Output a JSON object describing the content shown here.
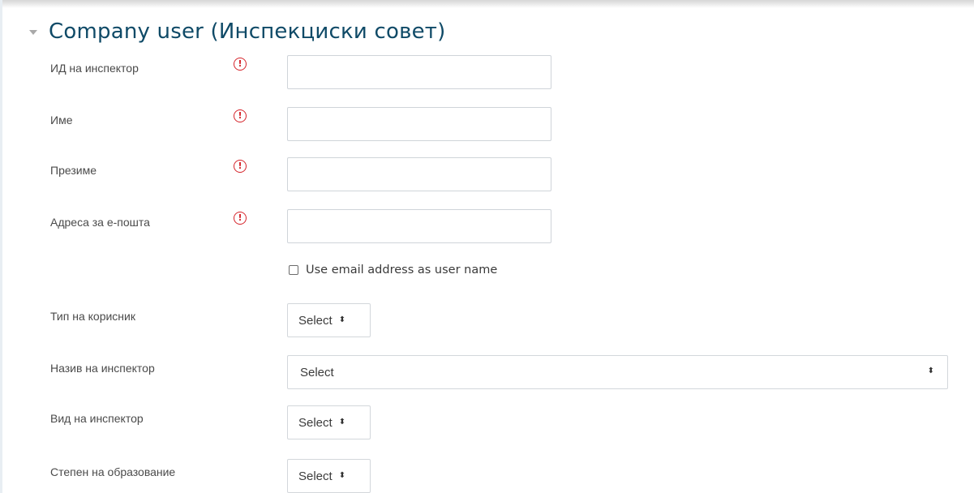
{
  "section": {
    "title": "Company user (Инспекциски совет)",
    "collapse_icon": "caret-down-icon"
  },
  "fields": {
    "inspector_id": {
      "label": "ИД на инспектор",
      "value": ""
    },
    "first_name": {
      "label": "Име",
      "value": ""
    },
    "last_name": {
      "label": "Презиме",
      "value": ""
    },
    "email": {
      "label": "Адреса за е-пошта",
      "value": ""
    }
  },
  "required_icon": {
    "name": "required-icon",
    "glyph": "!"
  },
  "use_email_checkbox": {
    "label": "Use email address as user name",
    "checked": false
  },
  "selects": {
    "user_type": {
      "label": "Тип на корисник",
      "value": "Select"
    },
    "inspector_title": {
      "label": "Назив на инспектор",
      "value": "Select"
    },
    "inspector_kind": {
      "label": "Вид на инспектор",
      "value": "Select"
    },
    "education_level": {
      "label": "Степен на образование",
      "value": "Select"
    }
  },
  "select_arrow": "⬍",
  "colors": {
    "title": "#0f4a67",
    "required": "#d5232a",
    "border": "#cfd4d9"
  }
}
